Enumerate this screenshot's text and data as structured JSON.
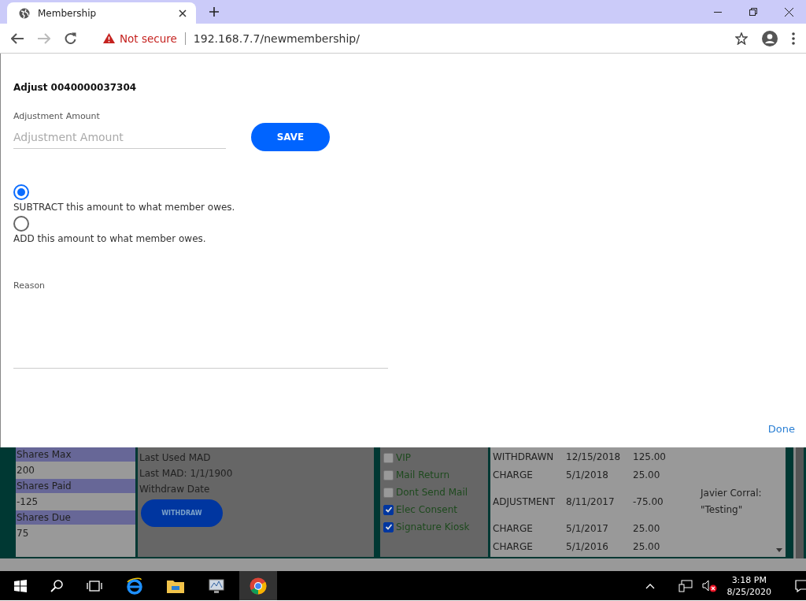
{
  "browser": {
    "tab_title": "Membership",
    "security": "Not secure",
    "url": "192.168.7.7/newmembership/"
  },
  "dialog": {
    "title": "Adjust 0040000037304",
    "amount_label": "Adjustment Amount",
    "amount_placeholder": "Adjustment Amount",
    "save_button": "SAVE",
    "options": [
      {
        "label": "SUBTRACT this amount to what member owes.",
        "selected": true
      },
      {
        "label": "ADD this amount to what member owes.",
        "selected": false
      }
    ],
    "reason_label": "Reason",
    "done_button": "Done"
  },
  "background": {
    "shares": [
      {
        "label": "Shares Max",
        "value": "200"
      },
      {
        "label": "Shares Paid",
        "value": "-125"
      },
      {
        "label": "Shares Due",
        "value": "75"
      }
    ],
    "info": [
      "Last Used MAD",
      "Last MAD: 1/1/1900",
      "Withdraw Date"
    ],
    "withdraw_button": "WITHDRAW",
    "flags": [
      {
        "label": "VIP",
        "checked": false
      },
      {
        "label": "Mail Return",
        "checked": false
      },
      {
        "label": "Dont Send Mail",
        "checked": false
      },
      {
        "label": "Elec Consent",
        "checked": true
      },
      {
        "label": "Signature Kiosk",
        "checked": true
      }
    ],
    "history": [
      {
        "type": "WITHDRAWN",
        "date": "12/15/2018",
        "amount": "125.00"
      },
      {
        "type": "CHARGE",
        "date": "5/1/2018",
        "amount": "25.00"
      },
      {
        "type": "ADJUSTMENT",
        "date": "8/11/2017",
        "amount": "-75.00",
        "note": "Javier Corral: \"Testing\""
      },
      {
        "type": "CHARGE",
        "date": "5/1/2017",
        "amount": "25.00"
      },
      {
        "type": "CHARGE",
        "date": "5/1/2016",
        "amount": "25.00"
      }
    ]
  },
  "taskbar": {
    "time": "3:18 PM",
    "date": "8/25/2020"
  }
}
